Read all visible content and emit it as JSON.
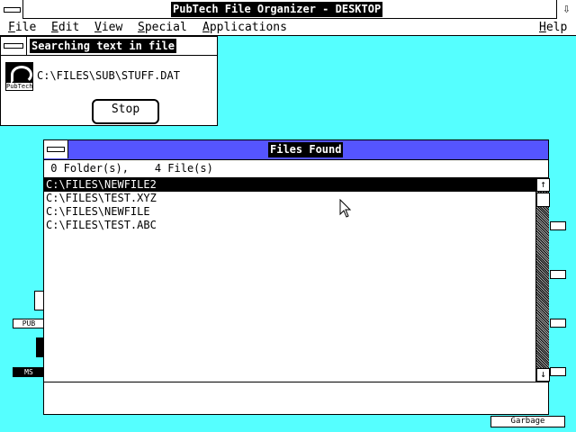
{
  "app": {
    "title": "PubTech File Organizer - DESKTOP",
    "scroll_arrow": "⇩"
  },
  "menubar": {
    "items": [
      {
        "label": "File",
        "underline": "F",
        "rest": "ile"
      },
      {
        "label": "Edit",
        "underline": "E",
        "rest": "dit"
      },
      {
        "label": "View",
        "underline": "V",
        "rest": "iew"
      },
      {
        "label": "Special",
        "underline": "S",
        "rest": "pecial"
      },
      {
        "label": "Applications",
        "underline": "A",
        "rest": "pplications"
      },
      {
        "label": "Help",
        "underline": "H",
        "rest": "elp"
      }
    ]
  },
  "search_dialog": {
    "title": "Searching text in file",
    "logo_text": "PubTech",
    "current_path": "C:\\FILES\\SUB\\STUFF.DAT",
    "stop_label": "Stop"
  },
  "files_found": {
    "title": "Files Found",
    "counts_line": " 0 Folder(s),    4 File(s)",
    "files": [
      "C:\\FILES\\NEWFILE2",
      "C:\\FILES\\TEST.XYZ",
      "C:\\FILES\\NEWFILE",
      "C:\\FILES\\TEST.ABC"
    ],
    "selected_index": 0,
    "scroll_up": "↑",
    "scroll_down": "↓"
  },
  "desktop_icons": {
    "pub_label": "PUB",
    "ms_label": "MS",
    "garbage_label": "Garbage"
  },
  "colors": {
    "desktop": "#55ffff",
    "active_title": "#5555ff",
    "selection": "#000000"
  }
}
